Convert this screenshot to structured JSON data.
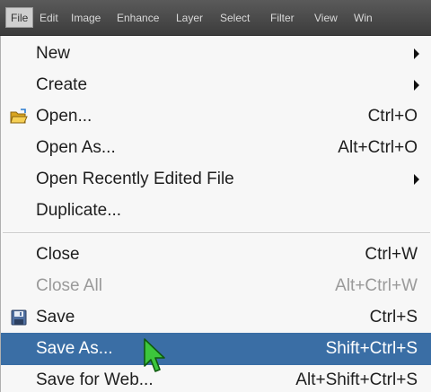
{
  "menubar": {
    "items": [
      "File",
      "Edit",
      "Image",
      "Enhance",
      "Layer",
      "Select",
      "Filter",
      "View",
      "Win"
    ]
  },
  "menu": {
    "new": {
      "label": "New"
    },
    "create": {
      "label": "Create"
    },
    "open": {
      "label": "Open...",
      "shortcut": "Ctrl+O",
      "icon": "folder-open-icon"
    },
    "open_as": {
      "label": "Open As...",
      "shortcut": "Alt+Ctrl+O"
    },
    "open_recent": {
      "label": "Open Recently Edited File"
    },
    "duplicate": {
      "label": "Duplicate..."
    },
    "close": {
      "label": "Close",
      "shortcut": "Ctrl+W"
    },
    "close_all": {
      "label": "Close All",
      "shortcut": "Alt+Ctrl+W",
      "disabled": true
    },
    "save": {
      "label": "Save",
      "shortcut": "Ctrl+S",
      "icon": "floppy-disk-icon"
    },
    "save_as": {
      "label": "Save As...",
      "shortcut": "Shift+Ctrl+S",
      "highlighted": true
    },
    "save_for_web": {
      "label": "Save for Web...",
      "shortcut": "Alt+Shift+Ctrl+S"
    }
  },
  "colors": {
    "highlight": "#3a6ea5",
    "menubar": "#4a4a4a",
    "cursor": "#3cc63c"
  }
}
